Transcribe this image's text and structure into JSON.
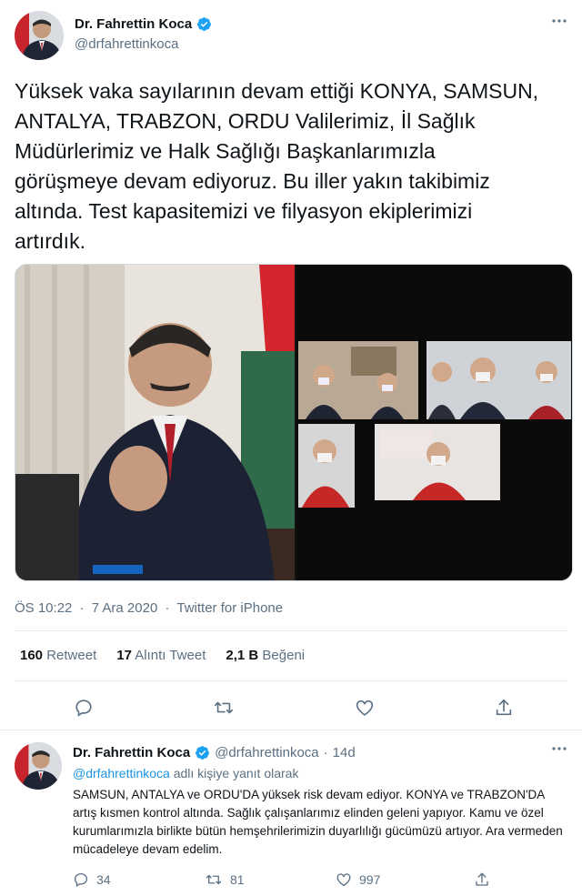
{
  "tweet": {
    "author": {
      "display_name": "Dr. Fahrettin Koca",
      "handle": "@drfahrettinkoca",
      "verified": true
    },
    "more_icon": "more-dots-icon",
    "text": "Yüksek vaka sayılarının devam ettiği KONYA, SAMSUN,\nANTALYA, TRABZON, ORDU Valilerimiz, İl Sağlık\nMüdürlerimiz ve Halk Sağlığı Başkanlarımızla\ngörüşmeye devam ediyoruz. Bu iller yakın takibimiz\naltında. Test kapasitemizi ve filyasyon ekiplerimizi\nartırdık.",
    "media": {
      "left_photo": "minister-at-laptop-photo",
      "right_photo": "video-conference-photo"
    },
    "time": "ÖS 10:22",
    "date": "7 Ara 2020",
    "source": "Twitter for iPhone",
    "separator": "·",
    "stats": {
      "retweets_count": "160",
      "retweets_label": "Retweet",
      "quotes_count": "17",
      "quotes_label": "Alıntı Tweet",
      "likes_count": "2,1 B",
      "likes_label": "Beğeni"
    },
    "actions": [
      "reply-icon",
      "retweet-icon",
      "like-icon",
      "share-icon"
    ]
  },
  "reply": {
    "author": {
      "display_name": "Dr. Fahrettin Koca",
      "handle": "@drfahrettinkoca",
      "verified": true
    },
    "separator": "·",
    "time": "14d",
    "replying_to_handle": "@drfahrettinkoca",
    "replying_to_suffix": "adlı kişiye yanıt olarak",
    "text": "SAMSUN, ANTALYA ve ORDU'DA yüksek risk devam ediyor. KONYA ve TRABZON'DA artış kısmen kontrol altında. Sağlık çalışanlarımız elinden geleni yapıyor. Kamu ve özel kurumlarımızla birlikte bütün hemşehrilerimizin duyarlılığı gücümüzü artıyor. Ara vermeden mücadeleye devam edelim.",
    "counts": {
      "replies": "34",
      "retweets": "81",
      "likes": "997"
    }
  },
  "colors": {
    "accent": "#1b95e0",
    "verified": "#1da1f2",
    "secondary_text": "#5b7083",
    "primary_text": "#0f1419",
    "divider": "#e6ecf0"
  }
}
